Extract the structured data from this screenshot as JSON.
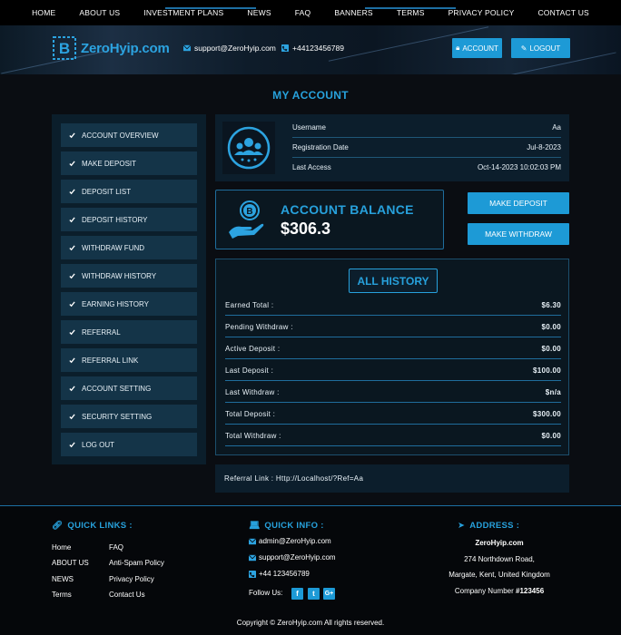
{
  "nav": [
    "HOME",
    "ABOUT US",
    "INVESTMENT PLANS",
    "NEWS",
    "FAQ",
    "BANNERS",
    "TERMS",
    "PRIVACY POLICY",
    "CONTACT US"
  ],
  "header": {
    "logo_text": "ZeroHyip.com",
    "email": "support@ZeroHyip.com",
    "phone": "+44123456789",
    "account_btn": "ACCOUNT",
    "logout_btn": "LOGOUT"
  },
  "page_title": "MY ACCOUNT",
  "sidebar": [
    "ACCOUNT OVERVIEW",
    "MAKE DEPOSIT",
    "DEPOSIT LIST",
    "DEPOSIT HISTORY",
    "WITHDRAW FUND",
    "WITHDRAW HISTORY",
    "EARNING HISTORY",
    "REFERRAL",
    "REFERRAL LINK",
    "ACCOUNT SETTING",
    "SECURITY SETTING",
    "LOG OUT"
  ],
  "profile": {
    "rows": [
      {
        "label": "Username",
        "value": "Aa"
      },
      {
        "label": "Registration Date",
        "value": "Jul-8-2023"
      },
      {
        "label": "Last Access",
        "value": "Oct-14-2023 10:02:03 PM"
      }
    ]
  },
  "balance": {
    "label": "ACCOUNT BALANCE",
    "value": "$306.3"
  },
  "actions": {
    "deposit": "MAKE DEPOSIT",
    "withdraw": "MAKE WITHDRAW"
  },
  "history": {
    "title": "ALL HISTORY",
    "rows": [
      {
        "label": "Earned Total :",
        "value": "$6.30"
      },
      {
        "label": "Pending Withdraw :",
        "value": "$0.00"
      },
      {
        "label": "Active Deposit :",
        "value": "$0.00"
      },
      {
        "label": "Last Deposit :",
        "value": "$100.00"
      },
      {
        "label": "Last Withdraw :",
        "value": "$n/a"
      },
      {
        "label": "Total Deposit :",
        "value": "$300.00"
      },
      {
        "label": "Total Withdraw :",
        "value": "$0.00"
      }
    ]
  },
  "referral": {
    "label": "Referral Link :",
    "value": "Http://Localhost/?Ref=Aa"
  },
  "footer": {
    "quick_links_title": "QUICK LINKS :",
    "links_col1": [
      "Home",
      "ABOUT US",
      "NEWS",
      "Terms"
    ],
    "links_col2": [
      "FAQ",
      "Anti-Spam Policy",
      "Privacy Policy",
      "Contact Us"
    ],
    "quick_info_title": "QUICK INFO :",
    "info_email1": "admin@ZeroHyip.com",
    "info_email2": "support@ZeroHyip.com",
    "info_phone": "+44 123456789",
    "follow_label": "Follow Us:",
    "social": [
      "f",
      "t",
      "G+"
    ],
    "address_title": "ADDRESS :",
    "address_name": "ZeroHyip.com",
    "address_line1": "274 Northdown Road,",
    "address_line2": "Margate, Kent, United Kingdom",
    "company_label": "Company Number",
    "company_number": "#123456",
    "copyright": "Copyright © ZeroHyip.com All rights reserved."
  },
  "colors": {
    "accent": "#1d9ad6",
    "title": "#27a1dc",
    "panel": "#0c1e2c",
    "sidebar_item": "#143448"
  }
}
